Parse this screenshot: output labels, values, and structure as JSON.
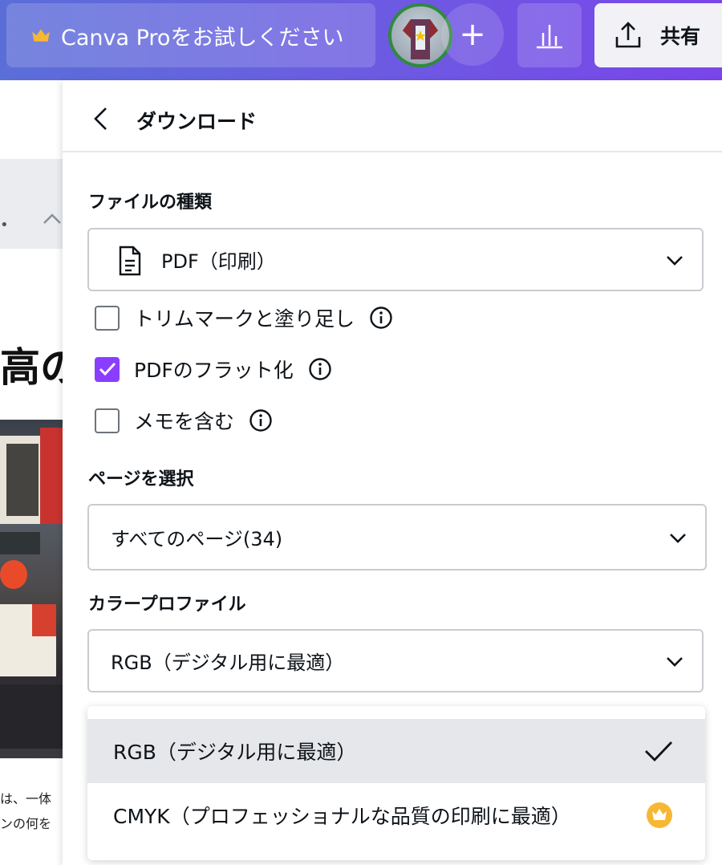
{
  "topbar": {
    "pro_label": "Canva Proをお試しください",
    "plus_label": "+",
    "share_label": "共有",
    "colors": {
      "gradient_start": "#5b6ed8",
      "gradient_end": "#7a45ea",
      "crown": "#f7b733"
    }
  },
  "background": {
    "title_fragment": "高の",
    "text_line1": "は、一体",
    "text_line2": "ンの何を"
  },
  "panel": {
    "title": "ダウンロード",
    "file_type": {
      "label": "ファイルの種類",
      "value": "PDF（印刷）",
      "icon": "document-icon"
    },
    "options": [
      {
        "label": "トリムマークと塗り足し",
        "checked": false
      },
      {
        "label": "PDFのフラット化",
        "checked": true
      },
      {
        "label": "メモを含む",
        "checked": false
      }
    ],
    "pages": {
      "label": "ページを選択",
      "value": "すべてのページ(34)"
    },
    "color_profile": {
      "label": "カラープロファイル",
      "value": "RGB（デジタル用に最適）",
      "menu": [
        {
          "label": "RGB（デジタル用に最適）",
          "selected": true,
          "icon": "check-icon"
        },
        {
          "label": "CMYK（プロフェッショナルな品質の印刷に最適）",
          "selected": false,
          "icon": "crown-icon"
        }
      ]
    },
    "accent_color": "#8b3dff"
  }
}
